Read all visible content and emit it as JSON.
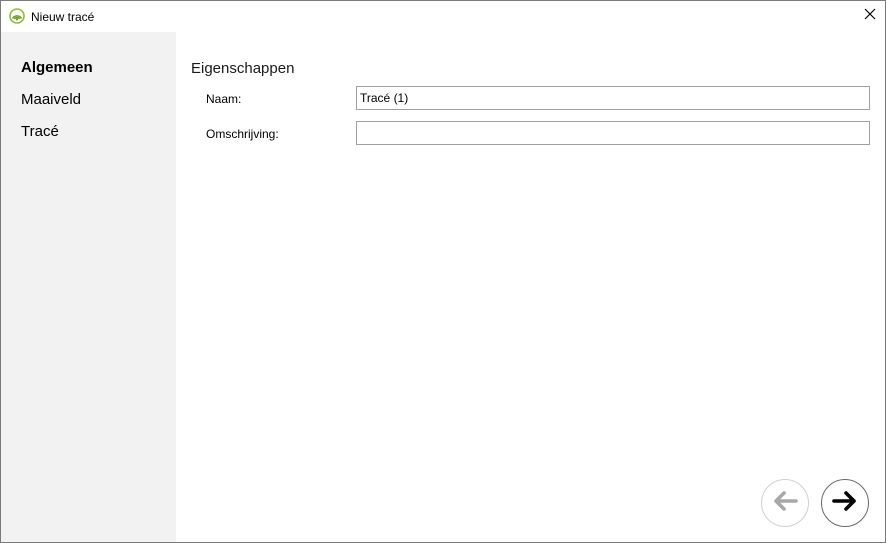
{
  "window": {
    "title": "Nieuw tracé",
    "app_icon": "concentric-arcs-icon",
    "close_icon": "close-icon"
  },
  "sidebar": {
    "items": [
      {
        "label": "Algemeen",
        "active": true
      },
      {
        "label": "Maaiveld",
        "active": false
      },
      {
        "label": "Tracé",
        "active": false
      }
    ]
  },
  "main": {
    "section_title": "Eigenschappen",
    "fields": {
      "naam": {
        "label": "Naam:",
        "value": "Tracé (1)",
        "placeholder": ""
      },
      "omschrijving": {
        "label": "Omschrijving:",
        "value": "",
        "placeholder": ""
      }
    }
  },
  "navigation": {
    "back": {
      "icon": "arrow-left-icon",
      "enabled": false
    },
    "next": {
      "icon": "arrow-right-icon",
      "enabled": true
    }
  },
  "colors": {
    "sidebar_bg": "#f2f2f2",
    "app_icon_green": "#8dbb3a",
    "disabled_arrow": "#a8a8a8",
    "active_arrow": "#000000"
  }
}
